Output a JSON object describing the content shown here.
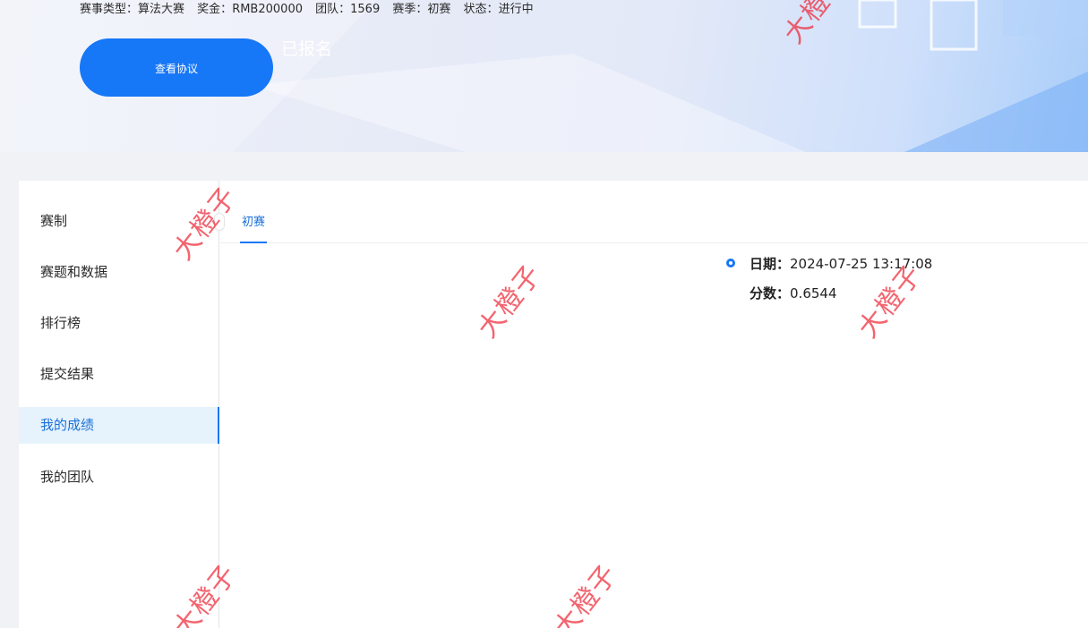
{
  "banner": {
    "info": [
      {
        "label": "赛事类型：",
        "value": "算法大赛"
      },
      {
        "label": "奖金：",
        "value": "RMB200000"
      },
      {
        "label": "团队：",
        "value": "1569"
      },
      {
        "label": "赛季：",
        "value": "初赛"
      },
      {
        "label": "状态：",
        "value": "进行中"
      }
    ],
    "register_button": {
      "main": "已报名",
      "sub": "查看协议"
    }
  },
  "sidebar": {
    "items": [
      {
        "label": "赛制"
      },
      {
        "label": "赛题和数据"
      },
      {
        "label": "排行榜"
      },
      {
        "label": "提交结果"
      },
      {
        "label": "我的成绩"
      },
      {
        "label": "我的团队"
      }
    ],
    "active_index": 4
  },
  "tabs": [
    {
      "label": "初赛"
    }
  ],
  "result": {
    "date_label": "日期：",
    "date_value": "2024-07-25 13:17:08",
    "score_label": "分数：",
    "score_value": "0.6544"
  },
  "watermark": {
    "text": "大橙子"
  },
  "colors": {
    "accent": "#1677f7",
    "watermark": "#ee2837",
    "active_bg": "#e6f3fd"
  }
}
